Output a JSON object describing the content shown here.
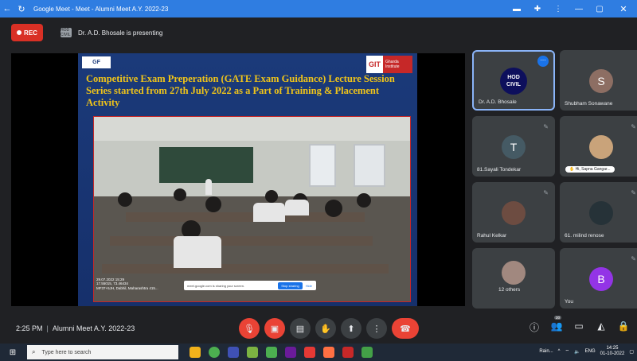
{
  "window": {
    "title": "Google Meet - Meet - Alumni Meet A.Y. 2022-23",
    "back_icon": "back-arrow-icon",
    "reload_icon": "reload-icon"
  },
  "presenting": {
    "rec_label": "REC",
    "presenter_text": "Dr. A.D. Bhosale is presenting",
    "presenter_icon_text": "HOD CIVIL"
  },
  "slide": {
    "logo_left": "GF",
    "logo_right_letter": "GIT",
    "logo_right_text": "Gharda Institute",
    "title": "Competitive Exam Preperation (GATE Exam Guidance) Lecture Session Series started from 27th July 2022 as a Part of Training & Placement Activity",
    "photo_meta": [
      "29.07.2022 15:29",
      "17.55015, 73.46434",
      "MF37+5JH, Dabhil, Maharashtra 415..."
    ],
    "share_text": "meet.google.com is sharing your screen.",
    "share_stop": "Stop sharing",
    "share_hide": "Hide"
  },
  "participants": [
    {
      "name": "Dr. A.D. Bhosale",
      "avatar": "HOD CIVIL",
      "color": "#0d0f5c",
      "active": true
    },
    {
      "name": "Shubham Sonawane",
      "avatar": "S",
      "color": "#8d6e63"
    },
    {
      "name": "81.Sayali Tondekar",
      "avatar": "T",
      "color": "#455a64"
    },
    {
      "name": "Hi, Sapna Gangar...",
      "avatar": "",
      "color": "#c9a37a"
    },
    {
      "name": "Rahul Kelkar",
      "avatar": "",
      "color": "#6d4c41"
    },
    {
      "name": "61. milind renose",
      "avatar": "",
      "color": "#263238"
    },
    {
      "name": "12 others",
      "avatar": "",
      "color": "#a1887f"
    },
    {
      "name": "You",
      "avatar": "B",
      "color": "#9334e6"
    }
  ],
  "bottom": {
    "time": "2:25 PM",
    "meeting_name": "Alumni Meet A.Y. 2022-23",
    "participant_count": "20"
  },
  "taskbar": {
    "search_placeholder": "Type here to search",
    "weather": "Rain...",
    "lang": "ENG",
    "clock_time": "14:25",
    "clock_date": "01-10-2022"
  }
}
